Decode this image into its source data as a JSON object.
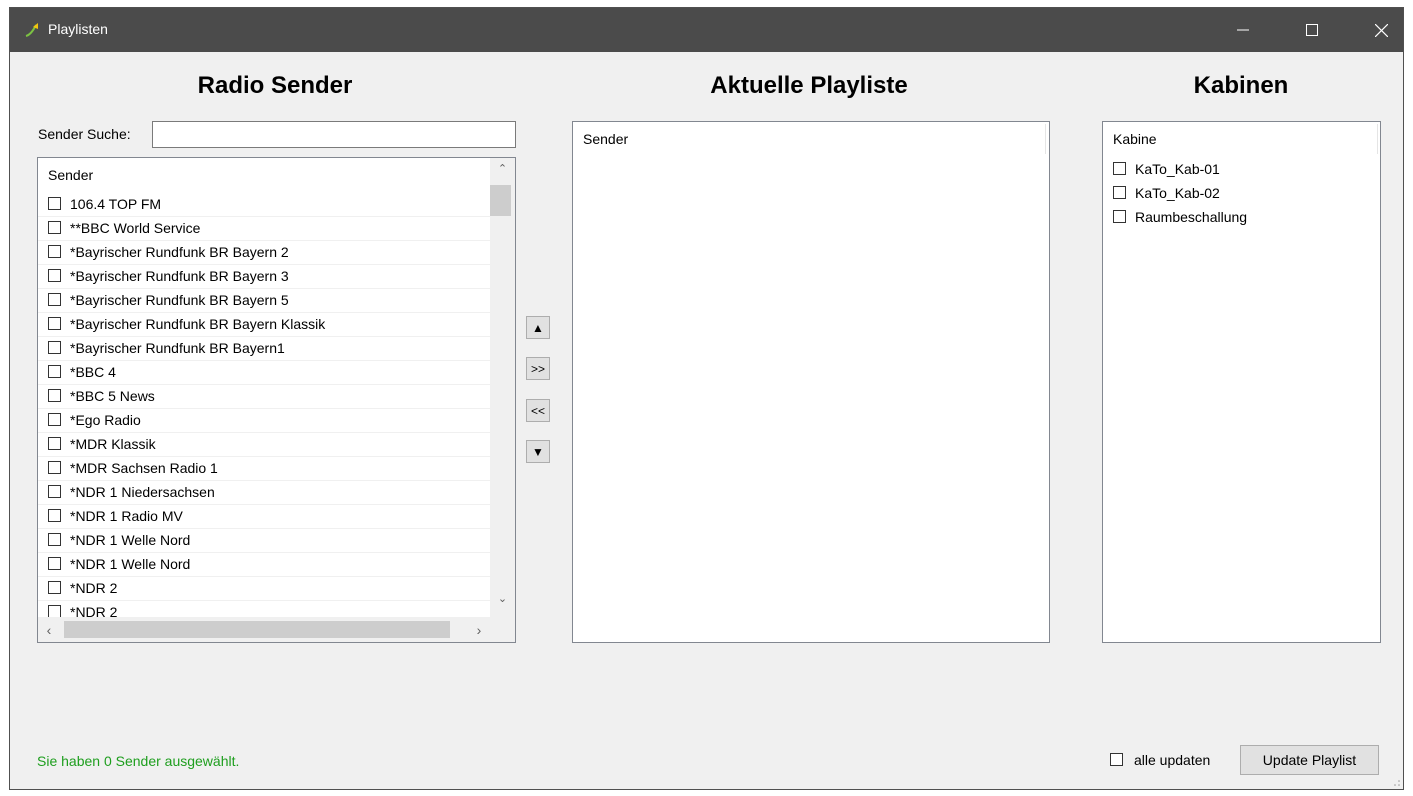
{
  "window": {
    "title": "Playlisten",
    "min_icon": "minimize-icon",
    "max_icon": "maximize-icon",
    "close_icon": "close-icon",
    "titlebar_color": "#4b4b4b"
  },
  "radio_sender": {
    "heading": "Radio Sender",
    "search_label": "Sender Suche:",
    "search_value": "",
    "column_header": "Sender",
    "items": [
      "106.4 TOP FM",
      "**BBC World Service",
      "*Bayrischer Rundfunk BR Bayern 2",
      "*Bayrischer Rundfunk BR Bayern 3",
      "*Bayrischer Rundfunk BR Bayern 5",
      "*Bayrischer Rundfunk BR Bayern Klassik",
      "*Bayrischer Rundfunk BR Bayern1",
      "*BBC 4",
      "*BBC 5 News",
      "*Ego Radio",
      "*MDR Klassik",
      "*MDR Sachsen Radio 1",
      "*NDR 1 Niedersachsen",
      "*NDR 1 Radio MV",
      "*NDR 1 Welle Nord",
      "*NDR 1 Welle Nord",
      "*NDR 2",
      "*NDR 2"
    ]
  },
  "move_buttons": {
    "up": "▲",
    "add": ">>",
    "remove": "<<",
    "down": "▼"
  },
  "playlist": {
    "heading": "Aktuelle Playliste",
    "column_header": "Sender"
  },
  "kabinen": {
    "heading": "Kabinen",
    "column_header": "Kabine",
    "items": [
      "KaTo_Kab-01",
      "KaTo_Kab-02",
      "Raumbeschallung"
    ]
  },
  "footer": {
    "status": "Sie haben 0 Sender ausgewählt.",
    "status_color": "#1e9e1e",
    "alle_updaten_label": "alle updaten",
    "update_button": "Update Playlist"
  }
}
